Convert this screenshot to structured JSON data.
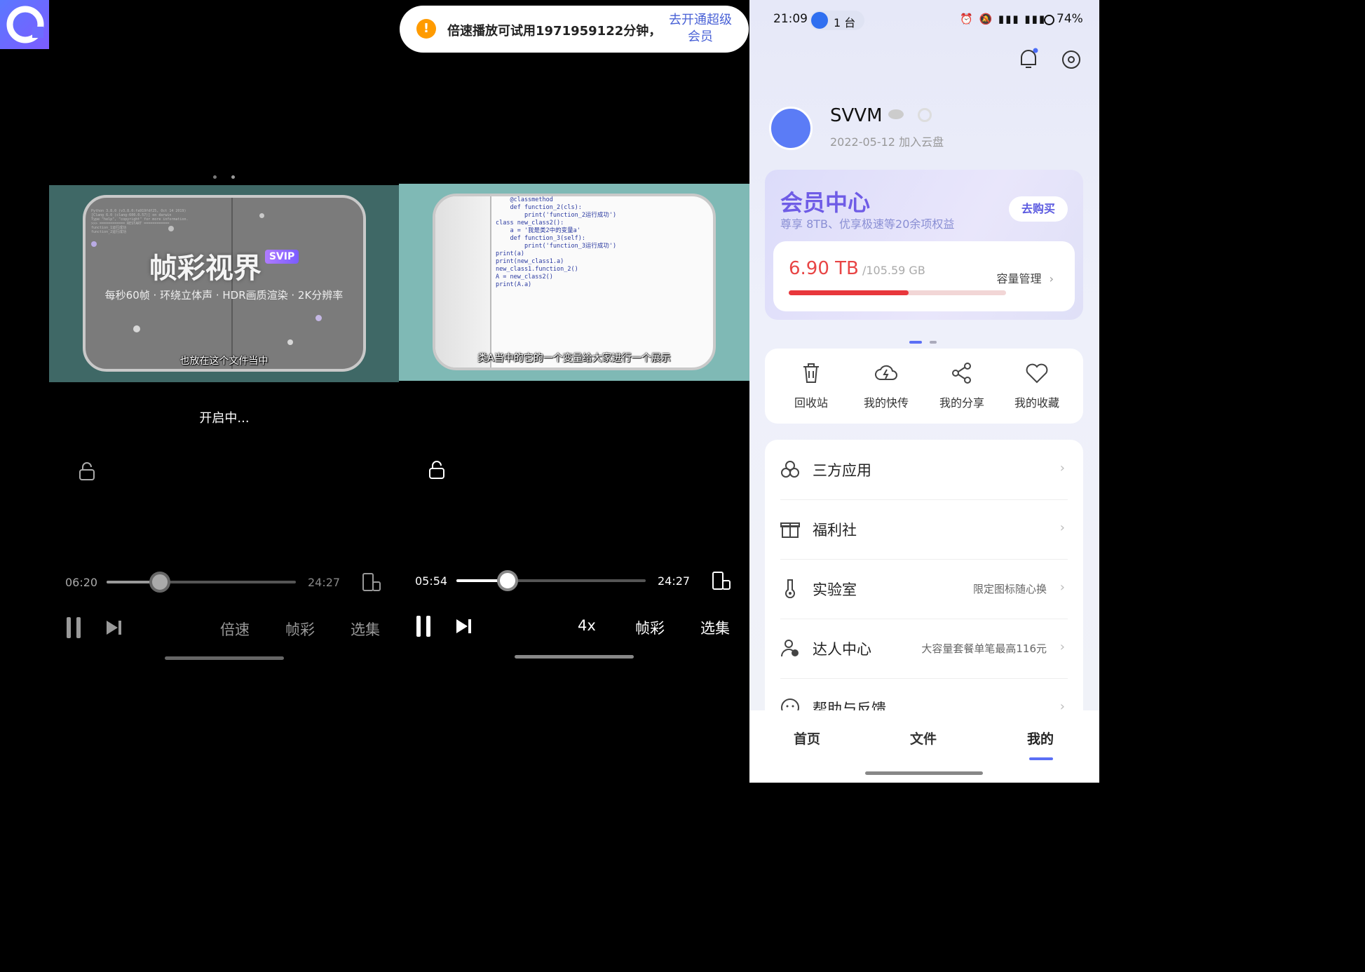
{
  "left_player": {
    "video_title": "帧彩视界",
    "video_badge": "SVIP",
    "video_features": "每秒60帧 · 环绕立体声 · HDR画质渲染 · 2K分辨率",
    "subtitle": "也放在这个文件当中",
    "status": "开启中...",
    "current_time": "06:20",
    "total_time": "24:27",
    "progress": 0.28,
    "speed_label": "倍速",
    "frame_label": "帧彩",
    "episodes_label": "选集"
  },
  "right_player": {
    "code_lines": [
      "    @classmethod",
      "    def function_2(cls):",
      "        print('function_2运行成功')",
      "",
      "class new_class2():",
      "    a = '我是类2中的变量a'",
      "    def function_3(self):",
      "        print('function_3运行成功')",
      "",
      "print(a)",
      "print(new_class1.a)",
      "new_class1.function_2()",
      "A = new_class2()",
      "print(A.a)"
    ],
    "subtitle": "类A当中的它的一个变量给大家进行一个展示",
    "current_time": "05:54",
    "total_time": "24:27",
    "progress": 0.27,
    "speed_label": "4x",
    "frame_label": "帧彩",
    "episodes_label": "选集"
  },
  "toast": {
    "message": "倍速播放可试用1971959122分钟，",
    "action_line1": "去开通超级",
    "action_line2": "会员"
  },
  "profile": {
    "status_time": "21:09",
    "status_devices": "1 台",
    "status_battery": "74%",
    "username": "SVVM",
    "join_date": "2022-05-12 加入云盘",
    "member": {
      "title": "会员中心",
      "subtitle": "尊享 8TB、优享极速等20余项权益",
      "buy_label": "去购买"
    },
    "storage": {
      "used": "6.90 TB",
      "total": "/105.59 GB",
      "manage_label": "容量管理",
      "fraction": 0.55
    },
    "grid": [
      {
        "label": "回收站",
        "icon": "trash-icon"
      },
      {
        "label": "我的快传",
        "icon": "cloud-bolt-icon"
      },
      {
        "label": "我的分享",
        "icon": "share-icon"
      },
      {
        "label": "我的收藏",
        "icon": "heart-icon"
      }
    ],
    "list": [
      {
        "title": "三方应用",
        "hint": "",
        "icon": "apps-icon"
      },
      {
        "title": "福利社",
        "hint": "",
        "icon": "gift-icon"
      },
      {
        "title": "实验室",
        "hint": "限定图标随心换",
        "icon": "flask-icon"
      },
      {
        "title": "达人中心",
        "hint": "大容量套餐单笔最高116元",
        "icon": "expert-icon"
      },
      {
        "title": "帮助与反馈",
        "hint": "",
        "icon": "help-icon"
      }
    ],
    "nav": {
      "home": "首页",
      "files": "文件",
      "mine": "我的"
    }
  }
}
